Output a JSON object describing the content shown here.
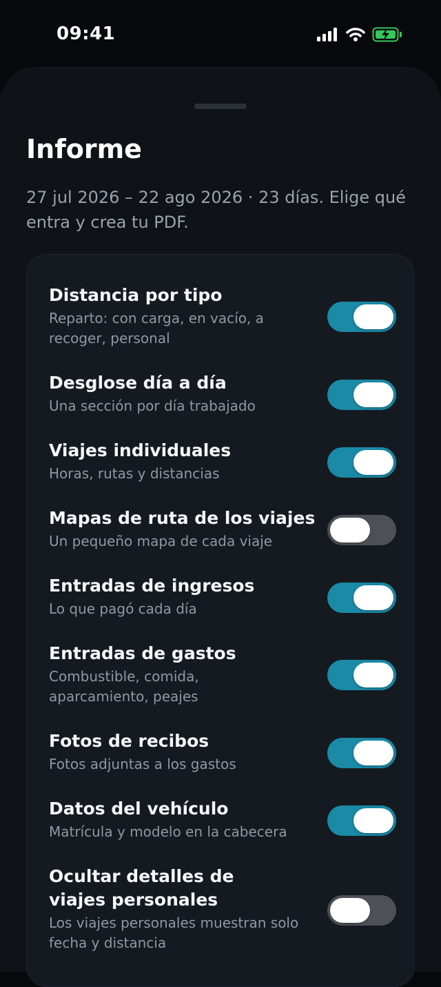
{
  "status_bar": {
    "time": "09:41",
    "icons": [
      "cellular-signal-icon",
      "wifi-icon",
      "battery-charging-icon"
    ],
    "battery_color": "#34c759"
  },
  "sheet": {
    "title": "Informe",
    "subtitle": "27 jul 2026 – 22 ago 2026 · 23 días. Elige qué entra y crea tu PDF."
  },
  "colors": {
    "toggle_on": "#1a8aa6",
    "toggle_off": "#4d5157",
    "background": "#07090c",
    "card": "#151a21"
  },
  "options": [
    {
      "title": "Distancia por tipo",
      "description": "Reparto: con carga, en vacío, a recoger, personal",
      "enabled": true
    },
    {
      "title": "Desglose día a día",
      "description": "Una sección por día trabajado",
      "enabled": true
    },
    {
      "title": "Viajes individuales",
      "description": "Horas, rutas y distancias",
      "enabled": true
    },
    {
      "title": "Mapas de ruta de los viajes",
      "description": "Un pequeño mapa de cada viaje",
      "enabled": false
    },
    {
      "title": "Entradas de ingresos",
      "description": "Lo que pagó cada día",
      "enabled": true
    },
    {
      "title": "Entradas de gastos",
      "description": "Combustible, comida, aparcamiento, peajes",
      "enabled": true
    },
    {
      "title": "Fotos de recibos",
      "description": "Fotos adjuntas a los gastos",
      "enabled": true
    },
    {
      "title": "Datos del vehículo",
      "description": "Matrícula y modelo en la cabecera",
      "enabled": true
    },
    {
      "title": "Ocultar detalles de viajes personales",
      "description": "Los viajes personales muestran solo fecha y distancia",
      "enabled": false
    }
  ]
}
